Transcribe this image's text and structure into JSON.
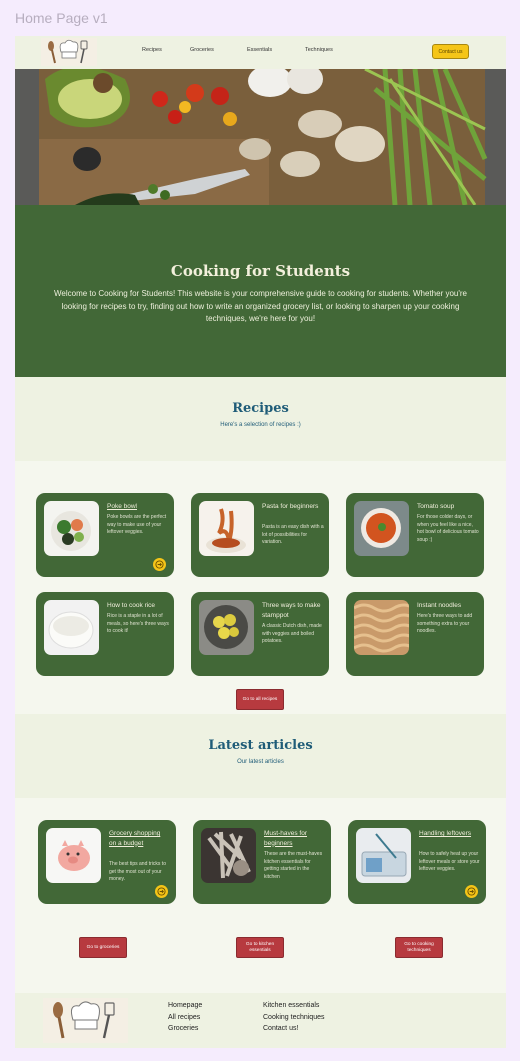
{
  "frame_title": "Home Page v1",
  "nav": {
    "links": [
      "Recipes",
      "Groceries",
      "Essentials",
      "Techniques"
    ],
    "contact": "Contact us"
  },
  "hero": {
    "title": "Cooking for Students",
    "text": "Welcome to Cooking for Students! This website is your comprehensive guide to cooking for students. Whether you're looking for recipes to try, finding out how to write an organized grocery list, or looking to sharpen up your cooking techniques, we're here for you!"
  },
  "recipes": {
    "title": "Recipes",
    "subtitle": "Here's a selection of recipes :)",
    "cards": [
      {
        "title": "Poke bowl",
        "desc": "Poke bowls are the perfect way to make use of your leftover veggies."
      },
      {
        "title": "Pasta for beginners",
        "desc": "Pasta is an easy dish with a lot of possibilities for variation."
      },
      {
        "title": "Tomato soup",
        "desc": "For those colder days, or when you feel like a nice, hot bowl of delicious tomato soup :)"
      },
      {
        "title": "How to cook rice",
        "desc": "Rice is a staple in a lot of meals, so here's three ways to cook it!"
      },
      {
        "title": "Three ways to make stamppot",
        "desc": "A classic Dutch dish, made with veggies and boiled potatoes."
      },
      {
        "title": "Instant noodles",
        "desc": "Here's three ways to add something extra to your noodles."
      }
    ],
    "button": "Go to all recipes"
  },
  "articles": {
    "title": "Latest articles",
    "subtitle": "Our latest articles",
    "cards": [
      {
        "title": "Grocery shopping on a budget",
        "desc": "The best tips and tricks to get the most out of your money."
      },
      {
        "title": "Must-haves for beginners",
        "desc": "These are the must-haves kitchen essentials for getting started in the kitchen"
      },
      {
        "title": "Handling leftovers",
        "desc": "How to safely heat up your leftover meals or store your leftover veggies."
      }
    ]
  },
  "go_buttons": [
    "Go to groceries",
    "Go to kitchen essentials",
    "Go to cooking techniques"
  ],
  "footer": {
    "col1": [
      "Homepage",
      "All recipes",
      "Groceries"
    ],
    "col2": [
      "Kitchen essentials",
      "Cooking techniques",
      "Contact us!"
    ]
  },
  "icons": {
    "card_arrow": "arrow-right-circle-icon",
    "logo": "chef-hat-utensils-logo"
  },
  "colors": {
    "green": "#426837",
    "accent_yellow": "#f5c518",
    "button_red": "#b73a3f",
    "heading_blue": "#1f5c78"
  }
}
